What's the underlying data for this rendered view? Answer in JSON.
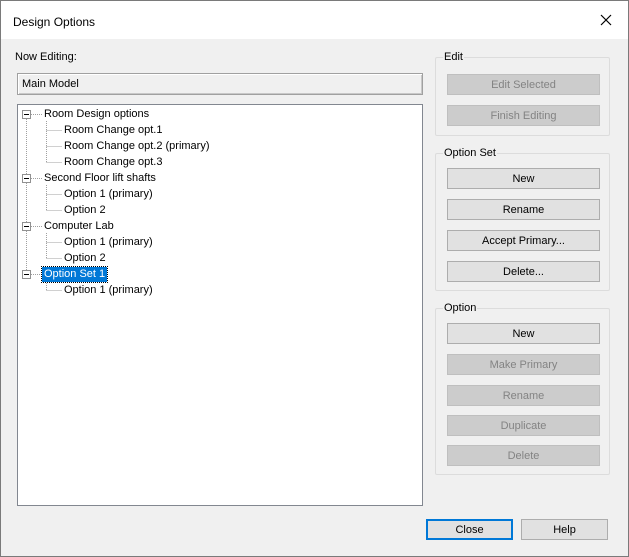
{
  "window": {
    "title": "Design Options"
  },
  "editing": {
    "label": "Now Editing:",
    "value": "Main Model"
  },
  "tree": [
    {
      "label": "Room Design options",
      "level": 0,
      "expanded": true
    },
    {
      "label": "Room Change opt.1",
      "level": 1
    },
    {
      "label": "Room Change opt.2 (primary)",
      "level": 1
    },
    {
      "label": "Room Change opt.3",
      "level": 1
    },
    {
      "label": "Second Floor lift shafts",
      "level": 0,
      "expanded": true
    },
    {
      "label": "Option 1 (primary)",
      "level": 1
    },
    {
      "label": "Option 2",
      "level": 1
    },
    {
      "label": "Computer Lab",
      "level": 0,
      "expanded": true
    },
    {
      "label": "Option 1 (primary)",
      "level": 1
    },
    {
      "label": "Option 2",
      "level": 1
    },
    {
      "label": "Option Set 1",
      "level": 0,
      "expanded": true,
      "selected": true
    },
    {
      "label": "Option 1 (primary)",
      "level": 1
    }
  ],
  "edit_group": {
    "label": "Edit",
    "edit_selected": "Edit Selected",
    "finish_editing": "Finish Editing"
  },
  "option_set_group": {
    "label": "Option Set",
    "new": "New",
    "rename": "Rename",
    "accept_primary": "Accept Primary...",
    "delete": "Delete..."
  },
  "option_group": {
    "label": "Option",
    "new": "New",
    "make_primary": "Make Primary",
    "rename": "Rename",
    "duplicate": "Duplicate",
    "delete": "Delete"
  },
  "footer": {
    "close": "Close",
    "help": "Help"
  },
  "colors": {
    "selection": "#0078d7",
    "dialog_bg": "#f0f0f0"
  }
}
